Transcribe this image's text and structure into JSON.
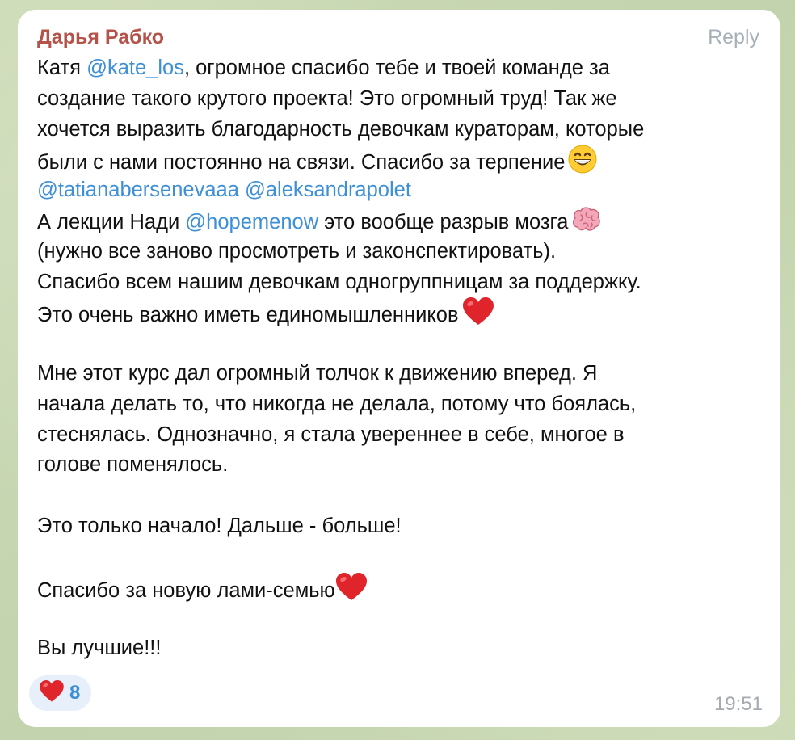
{
  "message": {
    "author": "Дарья Рабко",
    "reply_label": "Reply",
    "time": "19:51",
    "lines": [
      {
        "a": "Катя ",
        "m": "@kate_los",
        "b": ", огромное спасибо тебе и твоей команде за"
      },
      {
        "t": "создание такого крутого проекта! Это огромный труд! Так же"
      },
      {
        "t": "хочется выразить благодарность девочкам кураторам, которые"
      },
      {
        "t": "были с нами постоянно на связи. Спасибо за терпение"
      },
      {
        "m1": "@tatianaberseneva",
        "sep": "aa ",
        "m2": "@aleksandrapolet"
      },
      {
        "a": "А лекции Нади ",
        "m": "@hopemenow",
        "b": " это вообще разрыв мозга"
      },
      {
        "t": "(нужно все заново просмотреть и законспектировать)."
      },
      {
        "t": "Спасибо всем нашим девочкам одногруппницам за поддержку."
      },
      {
        "t": "Это очень важно иметь единомышленников"
      },
      {
        "t": "Мне этот курс дал огромный толчок к движению вперед. Я"
      },
      {
        "t": "начала делать то, что никогда не делала, потому что боялась,"
      },
      {
        "t": "стеснялась. Однозначно, я стала увереннее в себе, многое в"
      },
      {
        "t": "голове поменялось."
      },
      {
        "t": "Это только начало! Дальше - больше!"
      },
      {
        "t": "Спасибо за новую лами-семью"
      },
      {
        "t": "Вы лучшие!!!"
      }
    ]
  },
  "reaction": {
    "icon": "heart-icon",
    "count": "8"
  },
  "colors": {
    "author": "#b5524a",
    "mention": "#3d8fd6",
    "reaction_bg": "#e6effa",
    "heart": "#e0242b"
  }
}
